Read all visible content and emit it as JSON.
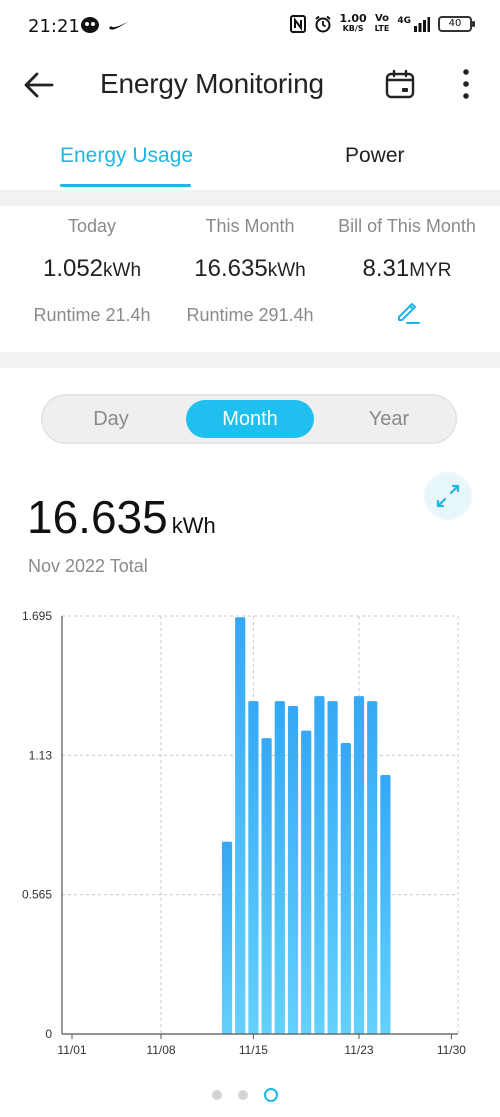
{
  "status_bar": {
    "time": "21:21",
    "net_speed_value": "1.00",
    "net_speed_unit": "KB/S",
    "volte_top": "Vo",
    "volte_bottom": "LTE",
    "network": "4G",
    "battery": "40"
  },
  "header": {
    "title": "Energy Monitoring",
    "back_icon": "arrow-left-icon",
    "calendar_icon": "calendar-icon",
    "more_icon": "more-vertical-icon"
  },
  "tabs": [
    {
      "label": "Energy Usage",
      "active": true
    },
    {
      "label": "Power",
      "active": false
    }
  ],
  "summary": {
    "today": {
      "label": "Today",
      "value": "1.052",
      "unit": "kWh",
      "sub": "Runtime 21.4h"
    },
    "month": {
      "label": "This Month",
      "value": "16.635",
      "unit": "kWh",
      "sub": "Runtime 291.4h"
    },
    "bill": {
      "label": "Bill of This Month",
      "value": "8.31",
      "unit": "MYR",
      "edit_icon": "edit-pencil-icon"
    }
  },
  "period_selector": {
    "options": [
      "Day",
      "Month",
      "Year"
    ],
    "selected": "Month"
  },
  "total": {
    "value": "16.635",
    "unit": "kWh",
    "label": "Nov 2022 Total",
    "expand_icon": "expand-icon"
  },
  "chart_data": {
    "type": "bar",
    "title": "",
    "xlabel": "",
    "ylabel": "",
    "y_ticks": [
      "0",
      "0.565",
      "1.13",
      "1.695"
    ],
    "ylim": [
      0,
      1.695
    ],
    "x_tick_labels": [
      "11/01",
      "11/08",
      "11/15",
      "11/23",
      "11/30"
    ],
    "x_tick_days": [
      1,
      8,
      15,
      23,
      30
    ],
    "x_range_days": [
      1,
      30
    ],
    "grid": true,
    "categories": [
      "11/13",
      "11/14",
      "11/15",
      "11/16",
      "11/17",
      "11/18",
      "11/19",
      "11/20",
      "11/21",
      "11/22",
      "11/23",
      "11/24",
      "11/25"
    ],
    "values": [
      0.78,
      1.69,
      1.35,
      1.2,
      1.35,
      1.33,
      1.23,
      1.37,
      1.35,
      1.18,
      1.37,
      1.35,
      1.05
    ],
    "colors": {
      "bar_top": "#35a8f5",
      "bar_bottom": "#63d1fb",
      "grid": "#c8c8c8",
      "axis": "#555555"
    }
  },
  "pager": {
    "count": 3,
    "active_index": 2
  }
}
